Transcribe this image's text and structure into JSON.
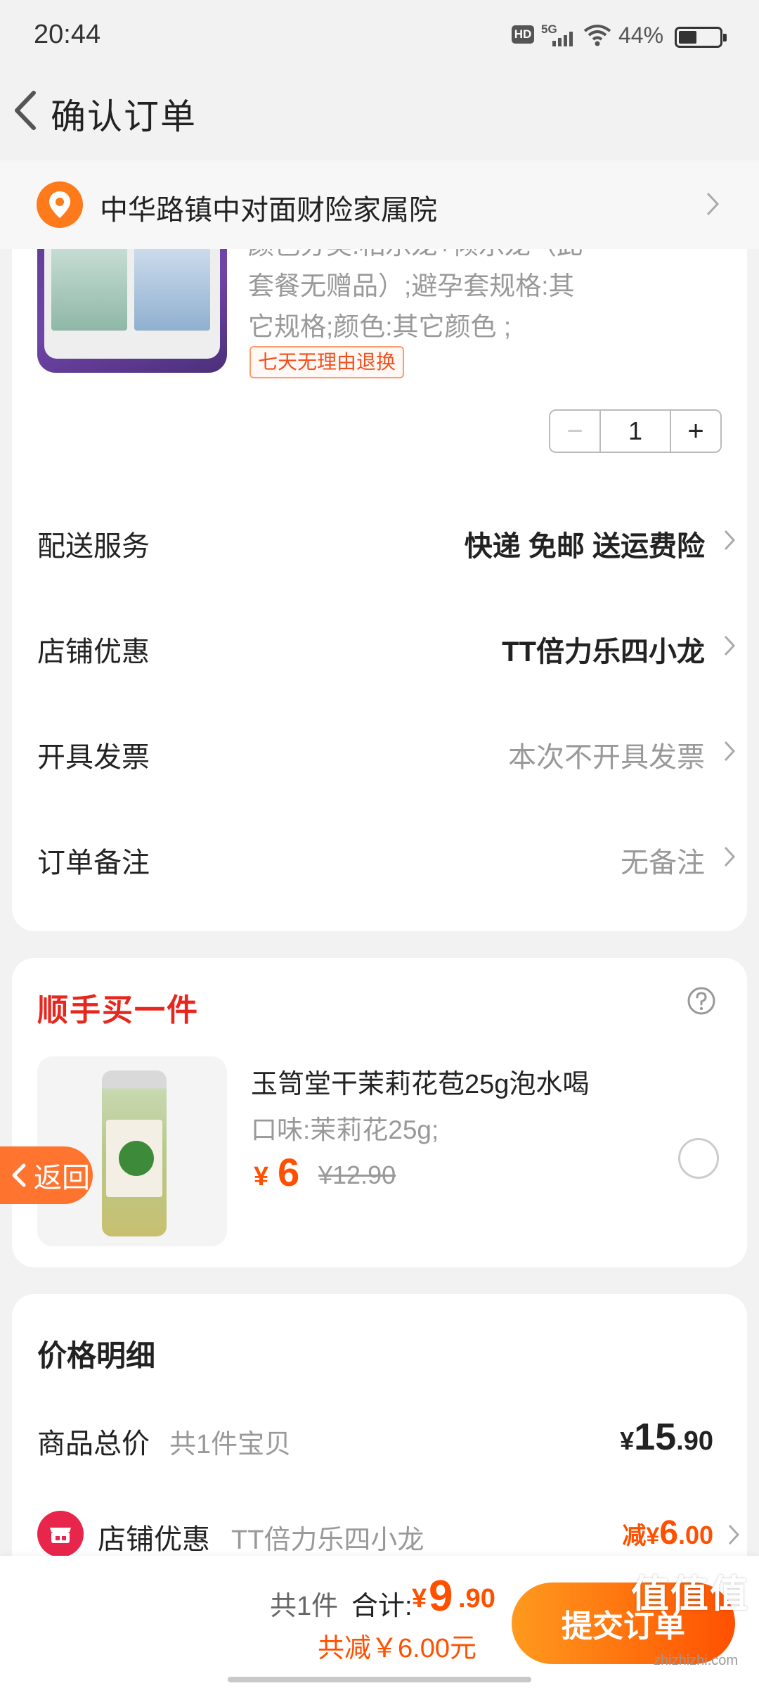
{
  "status_bar": {
    "time": "20:44",
    "hd": "HD",
    "network": "5G",
    "battery_pct": "44%",
    "battery_level": 0.44
  },
  "header": {
    "title": "确认订单",
    "back_icon": "chevron-left-icon"
  },
  "address": {
    "text": "中华路镇中对面财险家属院",
    "icon": "location-pin-icon"
  },
  "product": {
    "spec_lines": [
      "颜色分类:相乐龙+倾乐龙（此",
      "套餐无赠品）;避孕套规格:其",
      "它规格;颜色:其它颜色 ;"
    ],
    "return_tag": "七天无理由退换",
    "quantity": "1",
    "minus": "−",
    "plus": "+"
  },
  "rows": [
    {
      "label": "配送服务",
      "value": "快递 免邮 送运费险"
    },
    {
      "label": "店铺优惠",
      "value": "TT倍力乐四小龙"
    },
    {
      "label": "开具发票",
      "value": "本次不开具发票"
    },
    {
      "label": "订单备注",
      "value": "无备注"
    }
  ],
  "addon": {
    "title": "顺手买一件",
    "name": "玉笥堂干茉莉花苞25g泡水喝",
    "spec": "口味:茉莉花25g;",
    "currency": "¥",
    "price": "6",
    "original_price": "¥12.90",
    "help_icon": "question-circle-icon"
  },
  "float_back": {
    "label": "返回"
  },
  "price_detail": {
    "title": "价格明细",
    "total_label": "商品总价",
    "total_sub": "共1件宝贝",
    "total_currency": "¥",
    "total_int": "15",
    "total_dec": ".90",
    "shop_label": "店铺优惠",
    "shop_sub": "TT倍力乐四小龙",
    "shop_prefix": "减",
    "shop_currency": "¥",
    "shop_int": "6",
    "shop_dec": ".00"
  },
  "bottom_bar": {
    "count": "共1件",
    "total_label": "合计:",
    "currency": "¥",
    "total_int": "9",
    "total_dec": ".90",
    "reduced": "共减￥6.00元",
    "submit": "提交订单"
  },
  "watermark": {
    "text": "值值值",
    "url": "zhizhizhi.com"
  },
  "colors": {
    "accent": "#ff5000",
    "title_red": "#e8261e",
    "pin_orange": "#ff7a1a"
  }
}
